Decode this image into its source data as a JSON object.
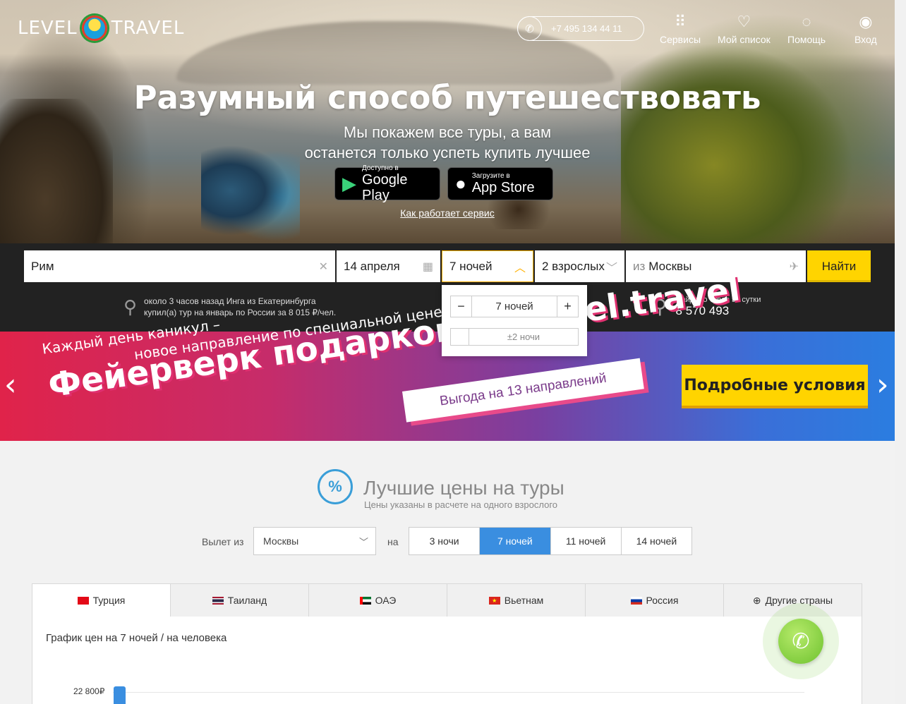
{
  "header": {
    "logo_left": "LEVEL",
    "logo_right": "TRAVEL",
    "phone": "+7 495 134 44 11",
    "nav": [
      {
        "label": "Сервисы",
        "icon": "grid-icon"
      },
      {
        "label": "Мой список",
        "icon": "heart-icon"
      },
      {
        "label": "Помощь",
        "icon": "bulb-icon"
      },
      {
        "label": "Вход",
        "icon": "user-icon"
      }
    ]
  },
  "hero": {
    "title": "Разумный способ путешествовать",
    "subtitle_line1": "Мы покажем все туры, а вам",
    "subtitle_line2": "останется только успеть купить лучшее",
    "google_small": "Доступно в",
    "google_big": "Google Play",
    "apple_small": "Загрузите в",
    "apple_big": "App Store",
    "how_link": "Как работает сервис"
  },
  "search": {
    "destination": "Рим",
    "date": "14 апреля",
    "nights": "7 ночей",
    "adults": "2 взрослых",
    "from_prefix": "из",
    "from_city": "Москвы",
    "submit": "Найти",
    "recent_line1": "около 3 часов назад Инга из Екатеринбурга",
    "recent_line2": "купил(а) тур на январь по России за 8 015 ₽/чел.",
    "found_label": "Найдено туров за сутки",
    "found_value": "8 570 493",
    "dropdown": {
      "minus": "−",
      "value": "7 ночей",
      "plus": "+",
      "flex_label": "±2 ночи"
    }
  },
  "banner": {
    "line1": "Каждый день каникул –",
    "line2": "новое направление по специальной цене",
    "headline": "Фейерверк подарков от Level.travel",
    "tag": "Выгода на 13 направлений",
    "button": "Подробные условия",
    "prev": "‹",
    "next": "›"
  },
  "best_prices": {
    "icon_glyph": "%",
    "title": "Лучшие цены на туры",
    "subtitle": "Цены указаны в расчете на одного взрослого",
    "departure_label": "Вылет из",
    "departure_value": "Москвы",
    "na_label": "на",
    "nights_tabs": [
      "3 ночи",
      "7 ночей",
      "11 ночей",
      "14 ночей"
    ],
    "active_nights_tab": 1,
    "country_tabs": [
      {
        "label": "Турция",
        "flag": "flag-tr-icon"
      },
      {
        "label": "Таиланд",
        "flag": "flag-th-icon"
      },
      {
        "label": "ОАЭ",
        "flag": "flag-ae-icon"
      },
      {
        "label": "Вьетнам",
        "flag": "flag-vn-icon"
      },
      {
        "label": "Россия",
        "flag": "flag-ru-icon"
      },
      {
        "label": "Другие страны",
        "flag": "globe-icon"
      }
    ],
    "active_country_tab": 0,
    "chart_title": "График цен на 7 ночей / на человека"
  },
  "chart_data": {
    "type": "bar",
    "y_tick_label": "22 800₽",
    "values_visible": [
      22800
    ],
    "color": "#3a8ee0"
  },
  "colors": {
    "accent_yellow": "#ffd400",
    "accent_blue": "#3a8ee0",
    "call_green": "#6ec22f"
  }
}
